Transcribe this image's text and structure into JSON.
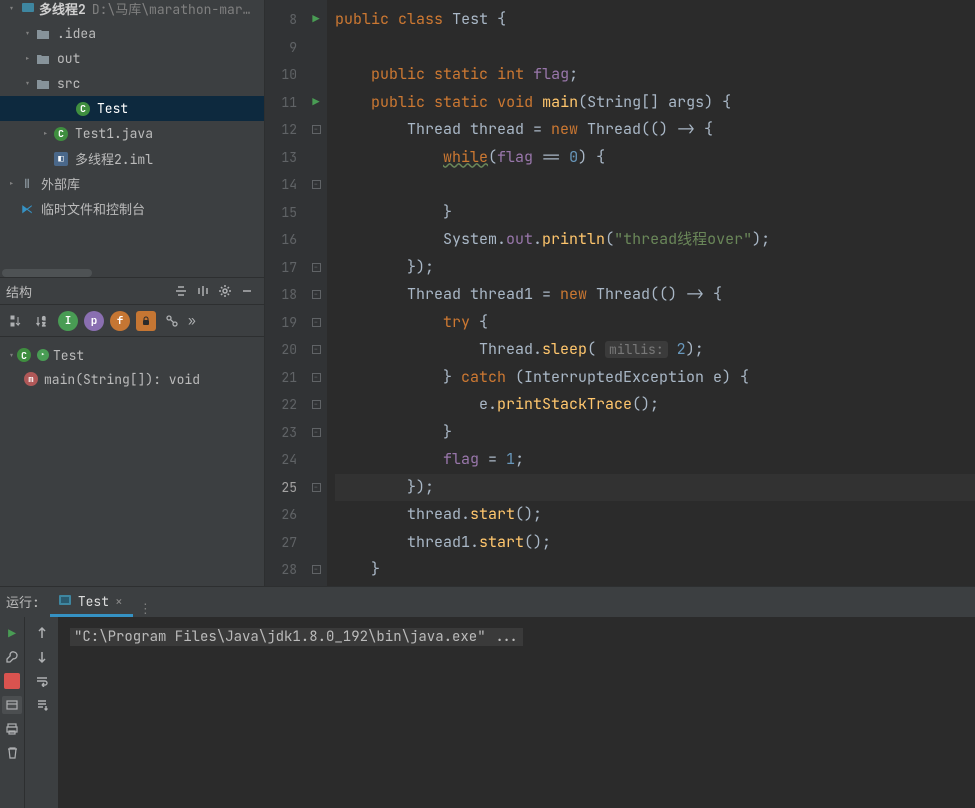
{
  "project": {
    "name": "多线程2",
    "path": "D:\\马库\\marathon-mar…"
  },
  "tree": [
    {
      "depth": 1,
      "caret": "▾",
      "type": "folder",
      "label": ".idea"
    },
    {
      "depth": 1,
      "caret": "▸",
      "type": "folder",
      "label": "out"
    },
    {
      "depth": 1,
      "caret": "▾",
      "type": "folder",
      "label": "src"
    },
    {
      "depth": 3,
      "caret": "",
      "type": "class",
      "label": "Test",
      "selected": true
    },
    {
      "depth": 2,
      "caret": "▸",
      "type": "class",
      "label": "Test1.java"
    },
    {
      "depth": 2,
      "caret": "",
      "type": "iml",
      "label": "多线程2.iml"
    },
    {
      "depth": 0,
      "caret": "▸",
      "type": "lib",
      "label": "外部库"
    },
    {
      "depth": 0,
      "caret": "",
      "type": "scratch",
      "label": "临时文件和控制台"
    }
  ],
  "structure": {
    "title": "结构",
    "items": [
      {
        "kind": "class",
        "label": "Test",
        "runnable": true
      },
      {
        "kind": "method",
        "label": "main(String[]): void"
      }
    ]
  },
  "editor": {
    "first_line_no": 8,
    "current_line_no": 25,
    "runnable_lines": [
      8,
      11
    ],
    "fold_lines": [
      12,
      14,
      17,
      18,
      19,
      20,
      21,
      22,
      23,
      25,
      28
    ],
    "lines": [
      {
        "html": "<span class='kw'>public</span> <span class='kw'>class</span> <span class='cls'>Test</span> {"
      },
      {
        "html": ""
      },
      {
        "html": "    <span class='kw'>public</span> <span class='kw'>static</span> <span class='kw'>int</span> <span class='field'>flag</span>;"
      },
      {
        "html": "    <span class='kw'>public</span> <span class='kw'>static</span> <span class='kw'>void</span> <span class='fn'>main</span>(String[] <span class='param'>args</span>) {"
      },
      {
        "html": "        Thread thread = <span class='kw'>new</span> Thread(() -> {"
      },
      {
        "html": "            <span class='kw under'>while</span>(<span class='field'>flag</span> == <span class='num'>0</span>) {"
      },
      {
        "html": ""
      },
      {
        "html": "            }"
      },
      {
        "html": "            System.<span class='field'>out</span>.<span class='fn'>println</span>(<span class='str'>\"thread线程over\"</span>);"
      },
      {
        "html": "        });"
      },
      {
        "html": "        Thread thread1 = <span class='kw'>new</span> Thread(() -> {"
      },
      {
        "html": "            <span class='kw'>try</span> {"
      },
      {
        "html": "                Thread.<span class='fn'>sleep</span>( <span class='hint'>millis:</span> <span class='num'>2</span>);"
      },
      {
        "html": "            } <span class='kw'>catch</span> (InterruptedException e) {"
      },
      {
        "html": "                e.<span class='fn'>printStackTrace</span>();"
      },
      {
        "html": "            }"
      },
      {
        "html": "            <span class='field'>flag</span> = <span class='num'>1</span>;"
      },
      {
        "html": "        });"
      },
      {
        "html": "        thread.<span class='fn'>start</span>();"
      },
      {
        "html": "        thread1.<span class='fn'>start</span>();"
      },
      {
        "html": "    }"
      }
    ]
  },
  "run": {
    "label": "运行:",
    "tab": "Test",
    "output_cmd": "\"C:\\Program Files\\Java\\jdk1.8.0_192\\bin\\java.exe\" ..."
  }
}
